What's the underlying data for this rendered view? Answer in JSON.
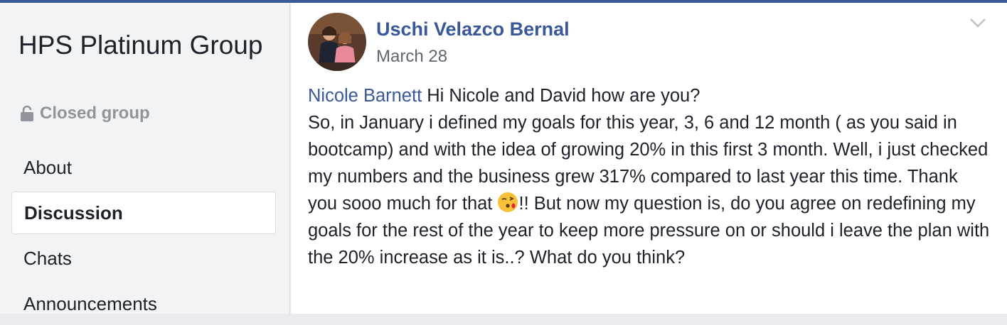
{
  "group": {
    "name": "HPS Platinum Group",
    "privacy": "Closed group",
    "nav": [
      {
        "label": "About"
      },
      {
        "label": "Discussion"
      },
      {
        "label": "Chats"
      },
      {
        "label": "Announcements"
      }
    ]
  },
  "post": {
    "author": "Uschi Velazco Bernal",
    "date": "March 28",
    "mention": "Nicole Barnett",
    "line1": " Hi Nicole and David how are you?",
    "text_before_emoji": "So, in January i defined my goals for this year, 3, 6 and 12 month ( as you said in bootcamp) and with the idea of growing 20% in this first 3 month. Well, i just checked my numbers and the business grew 317% compared to last year this time. Thank you sooo much for that ",
    "text_after_emoji": "!! But now my question is, do you agree on redefining my goals for the rest of the year to keep more pressure on or should i leave the plan with the 20% increase as it is..? What do you think?",
    "emoji": "kissing-face-emoji"
  },
  "icons": {
    "lock": "lock-icon",
    "chevron": "chevron-down-icon"
  }
}
